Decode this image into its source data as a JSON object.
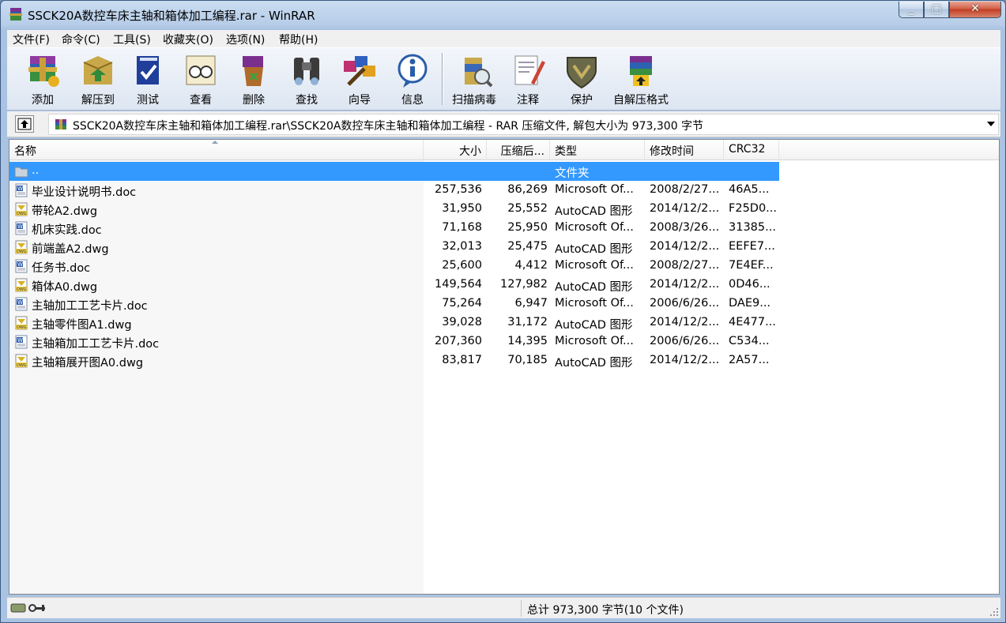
{
  "window": {
    "title": "SSCK20A数控车床主轴和箱体加工编程.rar - WinRAR",
    "min_glyph": "_",
    "max_glyph": "□",
    "close_glyph": "✕"
  },
  "menu": [
    {
      "label": "文件(F)"
    },
    {
      "label": "命令(C)"
    },
    {
      "label": "工具(S)"
    },
    {
      "label": "收藏夹(O)"
    },
    {
      "label": "选项(N)"
    },
    {
      "label": "帮助(H)"
    }
  ],
  "toolbar": [
    {
      "label": "添加",
      "icon": "add-archive-icon"
    },
    {
      "label": "解压到",
      "icon": "extract-to-icon"
    },
    {
      "label": "测试",
      "icon": "test-icon"
    },
    {
      "label": "查看",
      "icon": "view-icon"
    },
    {
      "label": "删除",
      "icon": "delete-icon"
    },
    {
      "label": "查找",
      "icon": "find-icon"
    },
    {
      "label": "向导",
      "icon": "wizard-icon"
    },
    {
      "label": "信息",
      "icon": "info-icon"
    },
    {
      "label": "扫描病毒",
      "icon": "virus-scan-icon"
    },
    {
      "label": "注释",
      "icon": "comment-icon"
    },
    {
      "label": "保护",
      "icon": "protect-icon"
    },
    {
      "label": "自解压格式",
      "icon": "sfx-icon"
    }
  ],
  "address": {
    "path": "SSCK20A数控车床主轴和箱体加工编程.rar\\SSCK20A数控车床主轴和箱体加工编程 - RAR 压缩文件, 解包大小为 973,300 字节"
  },
  "columns": {
    "name": "名称",
    "size": "大小",
    "packed": "压缩后...",
    "type": "类型",
    "modified": "修改时间",
    "crc": "CRC32"
  },
  "files": [
    {
      "name": "..",
      "size": "",
      "packed": "",
      "type": "文件夹",
      "modified": "",
      "crc": "",
      "kind": "folder",
      "selected": true
    },
    {
      "name": "毕业设计说明书.doc",
      "size": "257,536",
      "packed": "86,269",
      "type": "Microsoft Of...",
      "modified": "2008/2/27...",
      "crc": "46A5...",
      "kind": "doc"
    },
    {
      "name": "带轮A2.dwg",
      "size": "31,950",
      "packed": "25,552",
      "type": "AutoCAD 图形",
      "modified": "2014/12/2...",
      "crc": "F25D0...",
      "kind": "dwg"
    },
    {
      "name": "机床实践.doc",
      "size": "71,168",
      "packed": "25,950",
      "type": "Microsoft Of...",
      "modified": "2008/3/26...",
      "crc": "31385...",
      "kind": "doc"
    },
    {
      "name": "前端盖A2.dwg",
      "size": "32,013",
      "packed": "25,475",
      "type": "AutoCAD 图形",
      "modified": "2014/12/2...",
      "crc": "EEFE7...",
      "kind": "dwg"
    },
    {
      "name": "任务书.doc",
      "size": "25,600",
      "packed": "4,412",
      "type": "Microsoft Of...",
      "modified": "2008/2/27...",
      "crc": "7E4EF...",
      "kind": "doc"
    },
    {
      "name": "箱体A0.dwg",
      "size": "149,564",
      "packed": "127,982",
      "type": "AutoCAD 图形",
      "modified": "2014/12/2...",
      "crc": "0D46...",
      "kind": "dwg"
    },
    {
      "name": "主轴加工工艺卡片.doc",
      "size": "75,264",
      "packed": "6,947",
      "type": "Microsoft Of...",
      "modified": "2006/6/26...",
      "crc": "DAE9...",
      "kind": "doc"
    },
    {
      "name": "主轴零件图A1.dwg",
      "size": "39,028",
      "packed": "31,172",
      "type": "AutoCAD 图形",
      "modified": "2014/12/2...",
      "crc": "4E477...",
      "kind": "dwg"
    },
    {
      "name": "主轴箱加工工艺卡片.doc",
      "size": "207,360",
      "packed": "14,395",
      "type": "Microsoft Of...",
      "modified": "2006/6/26...",
      "crc": "C534...",
      "kind": "doc"
    },
    {
      "name": "主轴箱展开图A0.dwg",
      "size": "83,817",
      "packed": "70,185",
      "type": "AutoCAD 图形",
      "modified": "2014/12/2...",
      "crc": "2A57...",
      "kind": "dwg"
    }
  ],
  "status": {
    "summary": "总计 973,300 字节(10 个文件)"
  }
}
